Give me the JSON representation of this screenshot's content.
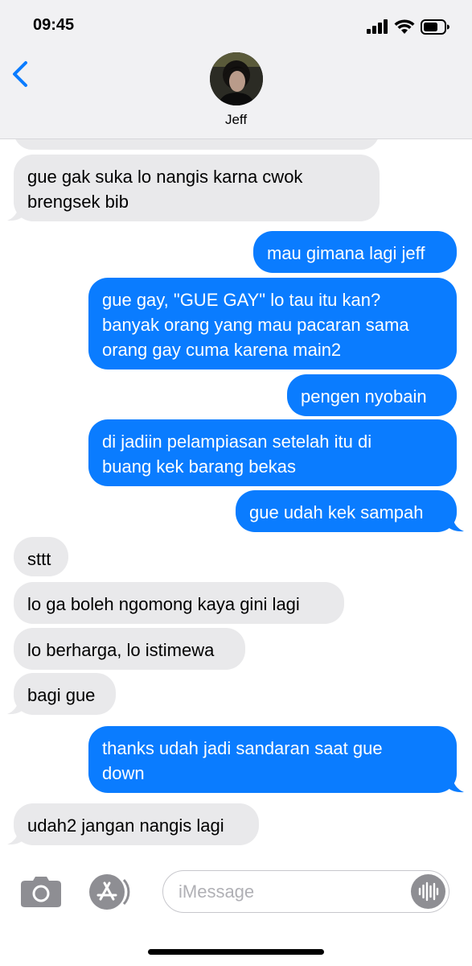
{
  "status_bar": {
    "time": "09:45"
  },
  "header": {
    "contact_name": "Jeff",
    "avatar_icon": "avatar-photo"
  },
  "messages": [
    {
      "side": "received",
      "lines": [
        "gue gak suka lo nangis karna cwok",
        "brengsek bib"
      ]
    },
    {
      "side": "sent",
      "lines": [
        "mau gimana lagi jeff"
      ]
    },
    {
      "side": "sent",
      "lines": [
        "gue gay, \"GUE GAY\" lo tau itu kan?",
        "banyak orang yang mau pacaran sama",
        "orang gay cuma karena main2"
      ]
    },
    {
      "side": "sent",
      "lines": [
        "pengen nyobain"
      ]
    },
    {
      "side": "sent",
      "lines": [
        "di jadiin pelampiasan setelah itu di",
        "buang kek barang bekas"
      ]
    },
    {
      "side": "sent",
      "lines": [
        "gue udah kek sampah"
      ]
    },
    {
      "side": "received",
      "lines": [
        "sttt"
      ]
    },
    {
      "side": "received",
      "lines": [
        "lo ga boleh ngomong kaya gini lagi"
      ]
    },
    {
      "side": "received",
      "lines": [
        "lo berharga, lo istimewa"
      ]
    },
    {
      "side": "received",
      "lines": [
        "bagi gue"
      ]
    },
    {
      "side": "sent",
      "lines": [
        "thanks udah jadi sandaran saat gue",
        "down"
      ]
    },
    {
      "side": "received",
      "lines": [
        "udah2 jangan nangis lagi"
      ]
    }
  ],
  "composer": {
    "placeholder": "iMessage",
    "camera_icon": "camera-icon",
    "apps_icon": "app-store-icon",
    "audio_icon": "audio-waveform-icon"
  },
  "colors": {
    "sent_bubble": "#0a7cff",
    "received_bubble": "#e9e9eb",
    "accent": "#0a7cff"
  }
}
